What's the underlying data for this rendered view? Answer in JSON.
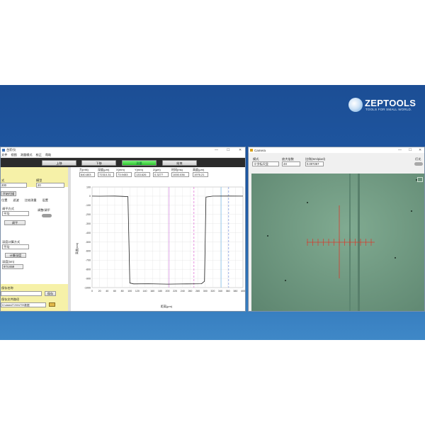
{
  "brand": {
    "name": "ZEPTOOLS",
    "tagline": "TOOLS FOR SMALL WORLD."
  },
  "left_window": {
    "title": "台阶仪",
    "window_controls": [
      "—",
      "☐",
      "✕"
    ],
    "menu": [
      "文件",
      "视图",
      "测量模式",
      "校正",
      "帮助"
    ],
    "toolbar": [
      "上移",
      "下移",
      "测量",
      "结束"
    ],
    "panel": {
      "label_a": "式",
      "label_b": "模型",
      "value_a": "200",
      "value_b": "20",
      "open_button": "开始扫描",
      "tabs": [
        "位置",
        "滤波",
        "比较测量",
        "设置"
      ],
      "level_label": "调平方式",
      "level_value": "平均",
      "motion_label": "调整/调平",
      "level_button": "调平",
      "depth_label": "深度计算方式",
      "depth_value": "平均",
      "calc_button": "计算深度",
      "depth_unit_label": "深度(nm)",
      "depth_value_num": "974.659",
      "save_label": "保存名称",
      "save_button": "保存",
      "path_label": "保存文件路径",
      "path_value": "D:\\data\\ZT200\\ZT5\\数据",
      "folder_icon": "folder-icon"
    },
    "readouts": {
      "labels": [
        "力(mN)",
        "深度(μm)",
        "X(mm)",
        "Y(mm)",
        "Z(μm)",
        "时间(ms)",
        "高度(μm)"
      ],
      "values": [
        "640.803",
        "72310.31",
        "73.9453",
        "133.626",
        "0.3277",
        "1000.036",
        "1976.21"
      ]
    },
    "chart_tools": [
      "▶",
      "≡",
      "⊞"
    ]
  },
  "chart_data": {
    "type": "line",
    "title": "",
    "xlabel": "距离(μm)",
    "ylabel": "高度(nm)",
    "xlim": [
      0,
      400
    ],
    "ylim": [
      -1000,
      100
    ],
    "xticks": [
      0,
      20,
      40,
      60,
      80,
      100,
      120,
      140,
      160,
      180,
      200,
      220,
      240,
      260,
      280,
      300,
      320,
      340,
      360,
      380,
      400
    ],
    "yticks": [
      100,
      0,
      -100,
      -200,
      -300,
      -400,
      -500,
      -600,
      -700,
      -800,
      -900,
      -1000
    ],
    "grid": true,
    "series": [
      {
        "color": "#222222",
        "x": [
          0,
          20,
          40,
          60,
          80,
          95,
          100,
          110,
          150,
          200,
          250,
          290,
          298,
          302,
          320,
          360,
          400
        ],
        "y": [
          0,
          -1,
          0,
          1,
          -2,
          -5,
          -950,
          -960,
          -958,
          -962,
          -960,
          -958,
          -930,
          -10,
          0,
          1,
          0
        ]
      }
    ],
    "markers": [
      {
        "x": 204,
        "color": "#d58fe0",
        "style": "solid"
      },
      {
        "x": 270,
        "color": "#e078d8",
        "style": "dashed"
      },
      {
        "x": 342,
        "color": "#84c0e8",
        "style": "solid"
      },
      {
        "x": 362,
        "color": "#8aa0e0",
        "style": "dashed"
      }
    ]
  },
  "right_window": {
    "title": "Camera",
    "window_controls": [
      "—",
      "☐",
      "✕"
    ],
    "labels": {
      "mode": "模式",
      "zoom": "放大倍数",
      "scale": "比例(mm/pixel)",
      "light": "灯光"
    },
    "values": {
      "mode": "十字标尺显",
      "zoom": "4X",
      "scale": "0.007257"
    },
    "crosshair_color": "#d83a2c"
  }
}
